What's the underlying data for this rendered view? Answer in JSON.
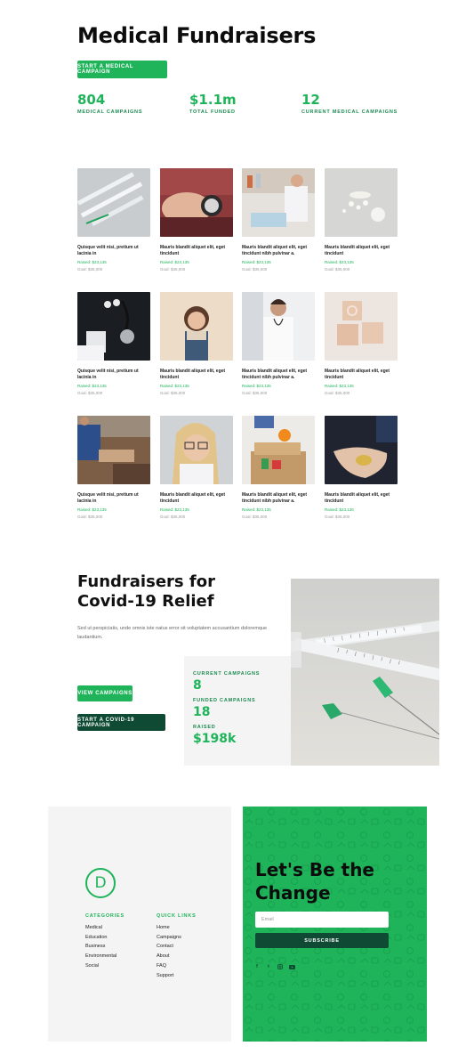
{
  "header": {
    "title": "Medical Fundraisers",
    "cta": "Start a Medical Campaign"
  },
  "stats": [
    {
      "value": "804",
      "label": "Medical Campaigns"
    },
    {
      "value": "$1.1m",
      "label": "Total Funded"
    },
    {
      "value": "12",
      "label": "Current Medical Campaigns"
    }
  ],
  "campaigns": [
    {
      "title": "Quisque velit nisi, pretium ut lacinia in",
      "raised": "Raised: $23,135",
      "goal": "Goal: $35,000",
      "image": "syringes-photo"
    },
    {
      "title": "Mauris blandit aliquet elit, eget tincidunt",
      "raised": "Raised: $23,135",
      "goal": "Goal: $35,000",
      "image": "blood-pressure-photo"
    },
    {
      "title": "Mauris blandit aliquet elit, eget tincidunt nibh pulvinar a.",
      "raised": "Raised: $23,135",
      "goal": "Goal: $35,000",
      "image": "lab-doctor-photo"
    },
    {
      "title": "Mauris blandit aliquet elit, eget tincidunt",
      "raised": "Raised: $23,135",
      "goal": "Goal: $35,000",
      "image": "pills-photo"
    },
    {
      "title": "Quisque velit nisi, pretium ut lacinia in",
      "raised": "Raised: $23,135",
      "goal": "Goal: $35,000",
      "image": "stethoscope-photo"
    },
    {
      "title": "Mauris blandit aliquet elit, eget tincidunt",
      "raised": "Raised: $23,135",
      "goal": "Goal: $35,000",
      "image": "girl-photo"
    },
    {
      "title": "Mauris blandit aliquet elit, eget tincidunt nibh pulvinar a.",
      "raised": "Raised: $23,135",
      "goal": "Goal: $35,000",
      "image": "doctor-photo"
    },
    {
      "title": "Mauris blandit aliquet elit, eget tincidunt",
      "raised": "Raised: $23,135",
      "goal": "Goal: $35,000",
      "image": "blocks-photo"
    },
    {
      "title": "Quisque velit nisi, pretium ut lacinia in",
      "raised": "Raised: $23,135",
      "goal": "Goal: $35,000",
      "image": "workshop-photo"
    },
    {
      "title": "Mauris blandit aliquet elit, eget tincidunt",
      "raised": "Raised: $23,135",
      "goal": "Goal: $35,000",
      "image": "glasses-photo"
    },
    {
      "title": "Mauris blandit aliquet elit, eget tincidunt nibh pulvinar a.",
      "raised": "Raised: $23,135",
      "goal": "Goal: $35,000",
      "image": "food-box-photo"
    },
    {
      "title": "Mauris blandit aliquet elit, eget tincidunt",
      "raised": "Raised: $23,135",
      "goal": "Goal: $35,000",
      "image": "hands-photo"
    }
  ],
  "covid": {
    "title": "Fundraisers for Covid-19 Relief",
    "description": "Sed ut perspiciatis, unde omnis iste natus error sit voluptatem accusantium doloremque laudantium.",
    "view_button": "View Campaigns",
    "start_button": "Start a Covid-19 Campaign",
    "stats": [
      {
        "label": "Current Campaigns",
        "value": "8"
      },
      {
        "label": "Funded Campaigns",
        "value": "18"
      },
      {
        "label": "Raised",
        "value": "$198k"
      }
    ],
    "image": "syringes-large-photo"
  },
  "footer": {
    "logo_letter": "D",
    "categories_label": "Categories",
    "categories": [
      "Medical",
      "Education",
      "Business",
      "Environmental",
      "Social"
    ],
    "quicklinks_label": "Quick Links",
    "quicklinks": [
      "Home",
      "Campaigns",
      "Contact",
      "About",
      "FAQ",
      "Support"
    ],
    "cta_title": "Let's Be the Change",
    "email_placeholder": "Email",
    "subscribe": "Subscribe",
    "social": [
      "f",
      "t",
      "i",
      "y"
    ]
  },
  "colors": {
    "accent": "#1fb45a",
    "dark_green": "#0f4a34",
    "light_bg": "#f4f4f4"
  }
}
